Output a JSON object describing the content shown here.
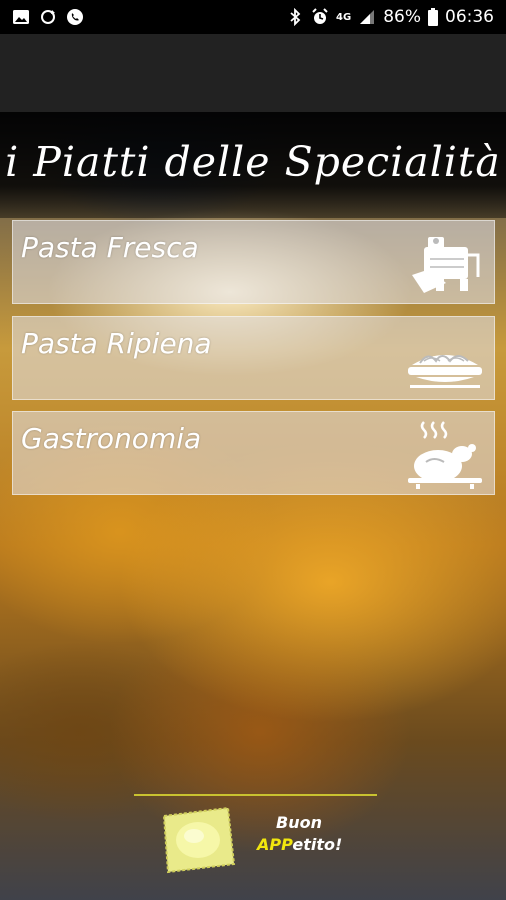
{
  "status_bar": {
    "left_icons": [
      "image-icon",
      "sync-icon",
      "whatsapp-icon"
    ],
    "right_icons": [
      "bluetooth-icon",
      "alarm-icon",
      "4g-icon",
      "signal-icon",
      "battery-icon"
    ],
    "network": "4G",
    "battery": "86%",
    "time": "06:36"
  },
  "header": {
    "title": "i Piatti delle Specialità"
  },
  "menu": {
    "items": [
      {
        "label": "Pasta Fresca",
        "icon": "pasta-machine-icon"
      },
      {
        "label": "Pasta Ripiena",
        "icon": "pasta-plate-icon"
      },
      {
        "label": "Gastronomia",
        "icon": "roast-chicken-icon"
      }
    ]
  },
  "footer": {
    "slogan_line1": "Buon",
    "slogan_app": "APP",
    "slogan_rest": "etito!",
    "accent_color": "#f1e60e"
  }
}
